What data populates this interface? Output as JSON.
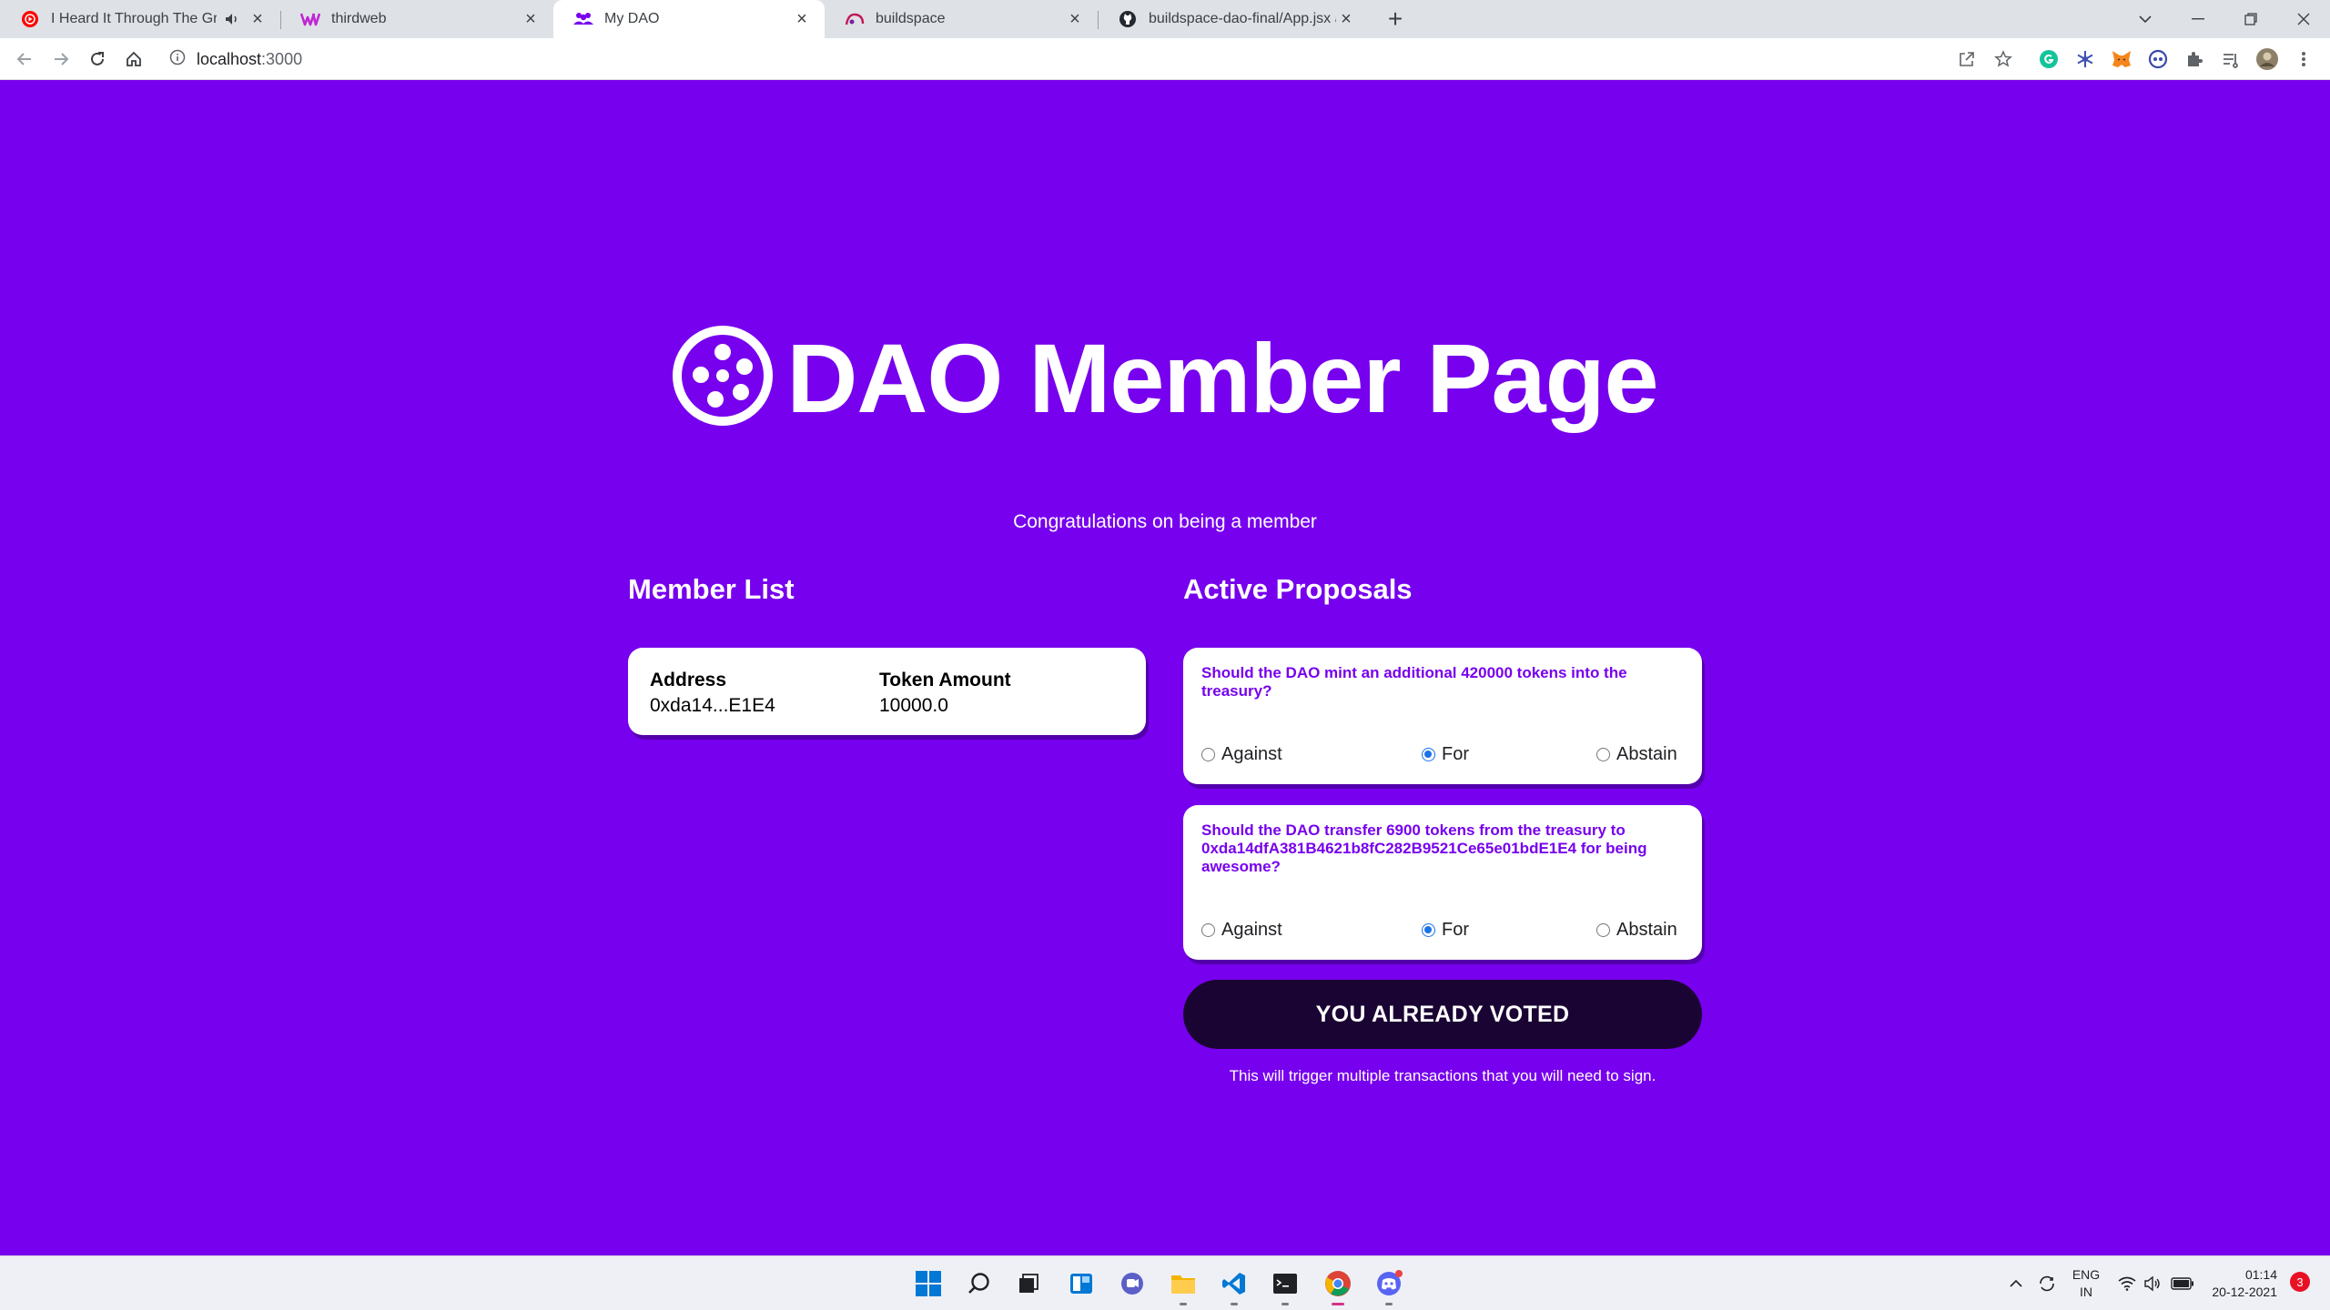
{
  "browser": {
    "tabs": [
      {
        "label": "I Heard It Through The Grape",
        "active": false
      },
      {
        "label": "thirdweb",
        "active": false
      },
      {
        "label": "My DAO",
        "active": true
      },
      {
        "label": "buildspace",
        "active": false
      },
      {
        "label": "buildspace-dao-final/App.jsx at d",
        "active": false
      }
    ],
    "url_host": "localhost",
    "url_port": ":3000"
  },
  "page": {
    "title": "DAO Member Page",
    "subtitle": "Congratulations on being a member",
    "member_list": {
      "heading": "Member List",
      "columns": [
        "Address",
        "Token Amount"
      ],
      "rows": [
        {
          "address": "0xda14...E1E4",
          "amount": "10000.0"
        }
      ]
    },
    "proposals": {
      "heading": "Active Proposals",
      "items": [
        {
          "question": "Should the DAO mint an additional 420000 tokens into the treasury?",
          "options": [
            "Against",
            "For",
            "Abstain"
          ],
          "selected": "For"
        },
        {
          "question": "Should the DAO transfer 6900 tokens from the treasury to 0xda14dfA381B4621b8fC282B9521Ce65e01bdE1E4 for being awesome?",
          "options": [
            "Against",
            "For",
            "Abstain"
          ],
          "selected": "For"
        }
      ]
    },
    "vote_button": "YOU ALREADY VOTED",
    "vote_note": "This will trigger multiple transactions that you will need to sign."
  },
  "taskbar": {
    "lang_top": "ENG",
    "lang_bottom": "IN",
    "time": "01:14",
    "date": "20-12-2021",
    "notifications": "3"
  },
  "colors": {
    "background": "#7700ee",
    "button_bg": "#1a0433",
    "proposal_text": "#7700ee"
  }
}
